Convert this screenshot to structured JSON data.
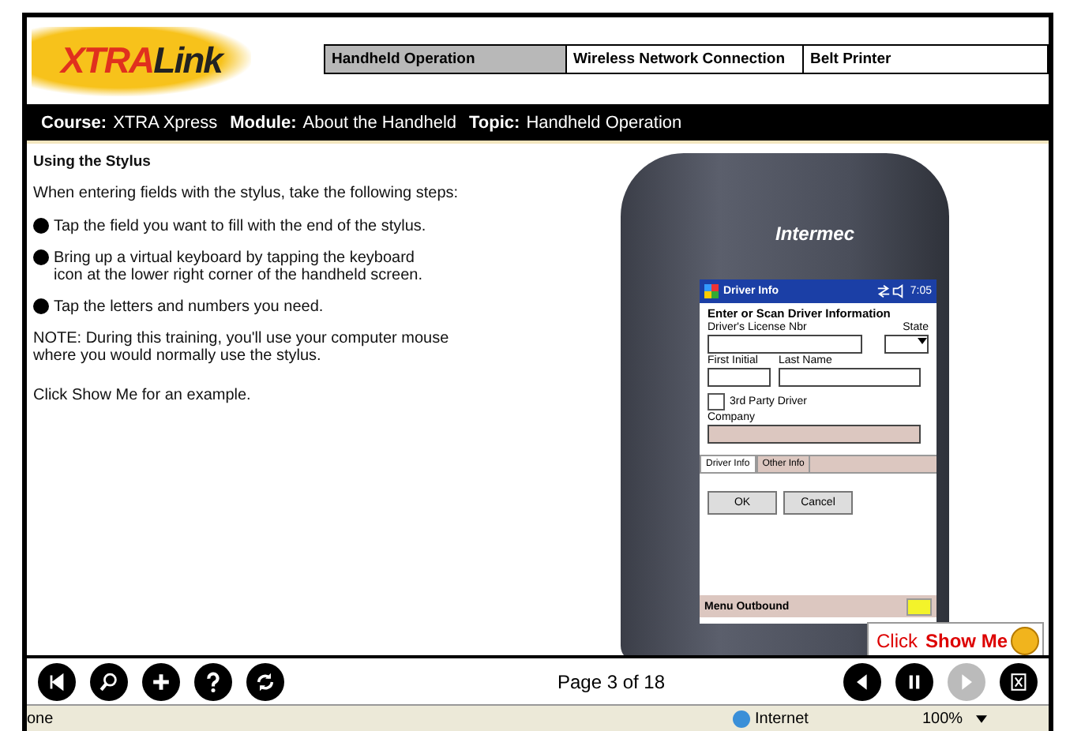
{
  "header": {
    "logo_a": "XTRA",
    "logo_b": "Link",
    "tabs": [
      {
        "label": "Handheld Operation",
        "selected": true
      },
      {
        "label": "Wireless Network Connection",
        "selected": false
      },
      {
        "label": "Belt Printer",
        "selected": false
      }
    ]
  },
  "breadcrumb": [
    {
      "label": "Course:",
      "value": "XTRA Xpress"
    },
    {
      "label": "Module:",
      "value": "About the Handheld"
    },
    {
      "label": "Topic:",
      "value": "Handheld Operation"
    }
  ],
  "lesson": {
    "heading": "Using the Stylus",
    "intro": "When entering fields with the stylus, take the following steps:",
    "steps": [
      "Tap the field you want to fill with the end of the stylus.",
      "Bring up a virtual keyboard by tapping the keyboard icon at the lower right corner of the handheld screen.",
      "Tap the letters and numbers you need."
    ],
    "note": "NOTE:  During this training, you'll use your computer mouse where you would normally use the stylus.",
    "prompt": "Click Show Me for an example."
  },
  "device": {
    "brand": "Intermec",
    "title": "Driver Info",
    "time": "7:05",
    "heading": "Enter or Scan Driver Information",
    "license_label": "Driver's License Nbr",
    "state_label": "State",
    "first_label": "First Initial",
    "last_label": "Last Name",
    "third_party": {
      "label": "3rd Party Driver",
      "checked": false
    },
    "company_label": "Company",
    "tabs": [
      {
        "label": "Driver Info",
        "selected": true
      },
      {
        "label": "Other Info",
        "selected": false
      }
    ],
    "buttons": [
      "OK",
      "Cancel"
    ],
    "menu": "Menu Outbound"
  },
  "show_me": {
    "text": "Click ",
    "bold": "Show Me"
  },
  "toolbar": {
    "left": [
      {
        "kind": "first"
      },
      {
        "kind": "search"
      },
      {
        "kind": "add"
      },
      {
        "kind": "help"
      },
      {
        "kind": "refresh"
      }
    ],
    "page": "Page 3 of 18",
    "right": [
      {
        "kind": "back",
        "disabled": false
      },
      {
        "kind": "pause",
        "disabled": false
      },
      {
        "kind": "next",
        "disabled": true
      },
      {
        "kind": "exit",
        "disabled": false
      }
    ]
  },
  "status_bar": {
    "left": "one",
    "zone": "Internet",
    "zoom": "100%"
  }
}
